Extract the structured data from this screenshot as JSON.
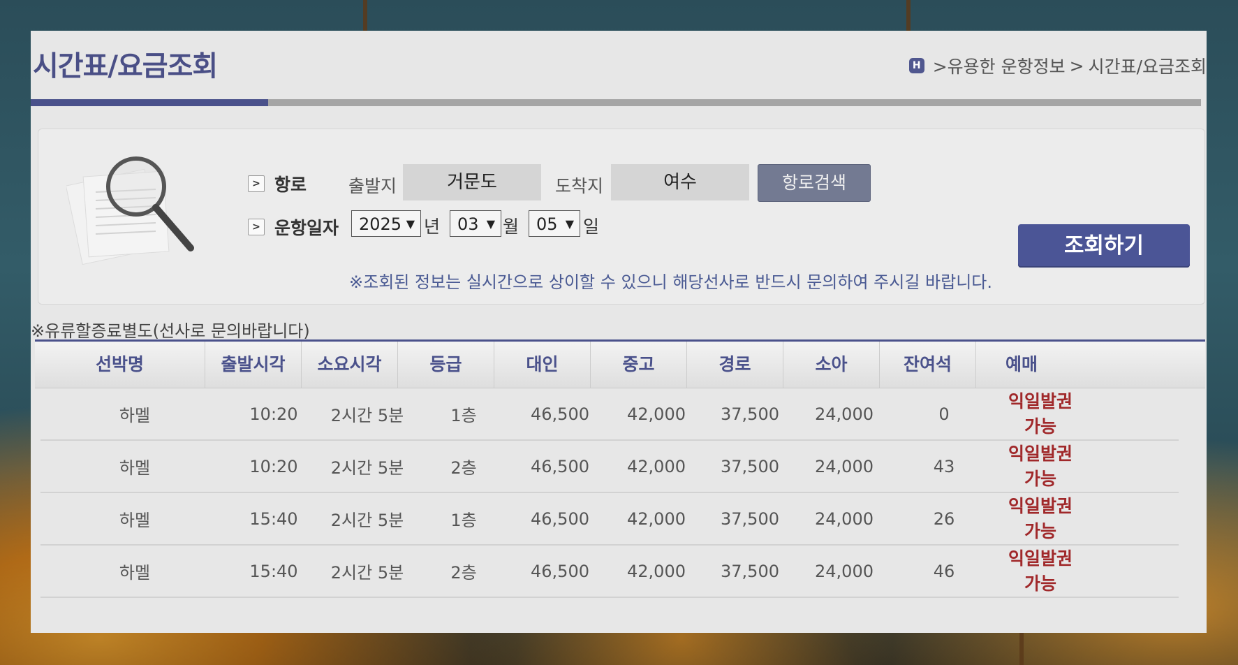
{
  "page": {
    "title": "시간표/요금조회",
    "breadcrumb": [
      ">유용한 운항정보",
      ">",
      "시간표/요금조회"
    ]
  },
  "search": {
    "route_label": "항로",
    "departure_label": "출발지",
    "departure_value": "거문도",
    "arrival_label": "도착지",
    "arrival_value": "여수",
    "route_search_button": "항로검색",
    "date_label": "운항일자",
    "year": "2025",
    "year_unit": "년",
    "month": "03",
    "month_unit": "월",
    "day": "05",
    "day_unit": "일",
    "query_button": "조회하기",
    "notice": "※조회된 정보는 실시간으로 상이할 수 있으니 해당선사로 반드시 문의하여 주시길 바랍니다."
  },
  "fuel_note": "※유류할증료별도(선사로 문의바랍니다)",
  "table": {
    "headers": [
      "선박명",
      "출발시각",
      "소요시각",
      "등급",
      "대인",
      "중고",
      "경로",
      "소아",
      "잔여석",
      "예매"
    ],
    "rows": [
      {
        "ship": "하멜",
        "depart": "10:20",
        "duration": "2시간 5분",
        "grade": "1층",
        "adult": "46,500",
        "youth": "42,000",
        "senior": "37,500",
        "child": "24,000",
        "seats": "0",
        "reserve_1": "익일발권",
        "reserve_2": "가능"
      },
      {
        "ship": "하멜",
        "depart": "10:20",
        "duration": "2시간 5분",
        "grade": "2층",
        "adult": "46,500",
        "youth": "42,000",
        "senior": "37,500",
        "child": "24,000",
        "seats": "43",
        "reserve_1": "익일발권",
        "reserve_2": "가능"
      },
      {
        "ship": "하멜",
        "depart": "15:40",
        "duration": "2시간 5분",
        "grade": "1층",
        "adult": "46,500",
        "youth": "42,000",
        "senior": "37,500",
        "child": "24,000",
        "seats": "26",
        "reserve_1": "익일발권",
        "reserve_2": "가능"
      },
      {
        "ship": "하멜",
        "depart": "15:40",
        "duration": "2시간 5분",
        "grade": "2층",
        "adult": "46,500",
        "youth": "42,000",
        "senior": "37,500",
        "child": "24,000",
        "seats": "46",
        "reserve_1": "익일발권",
        "reserve_2": "가능"
      }
    ]
  },
  "colors": {
    "accent": "#4a518b",
    "reserve_text": "#a0282a",
    "panel_bg": "#e7e7e7"
  }
}
